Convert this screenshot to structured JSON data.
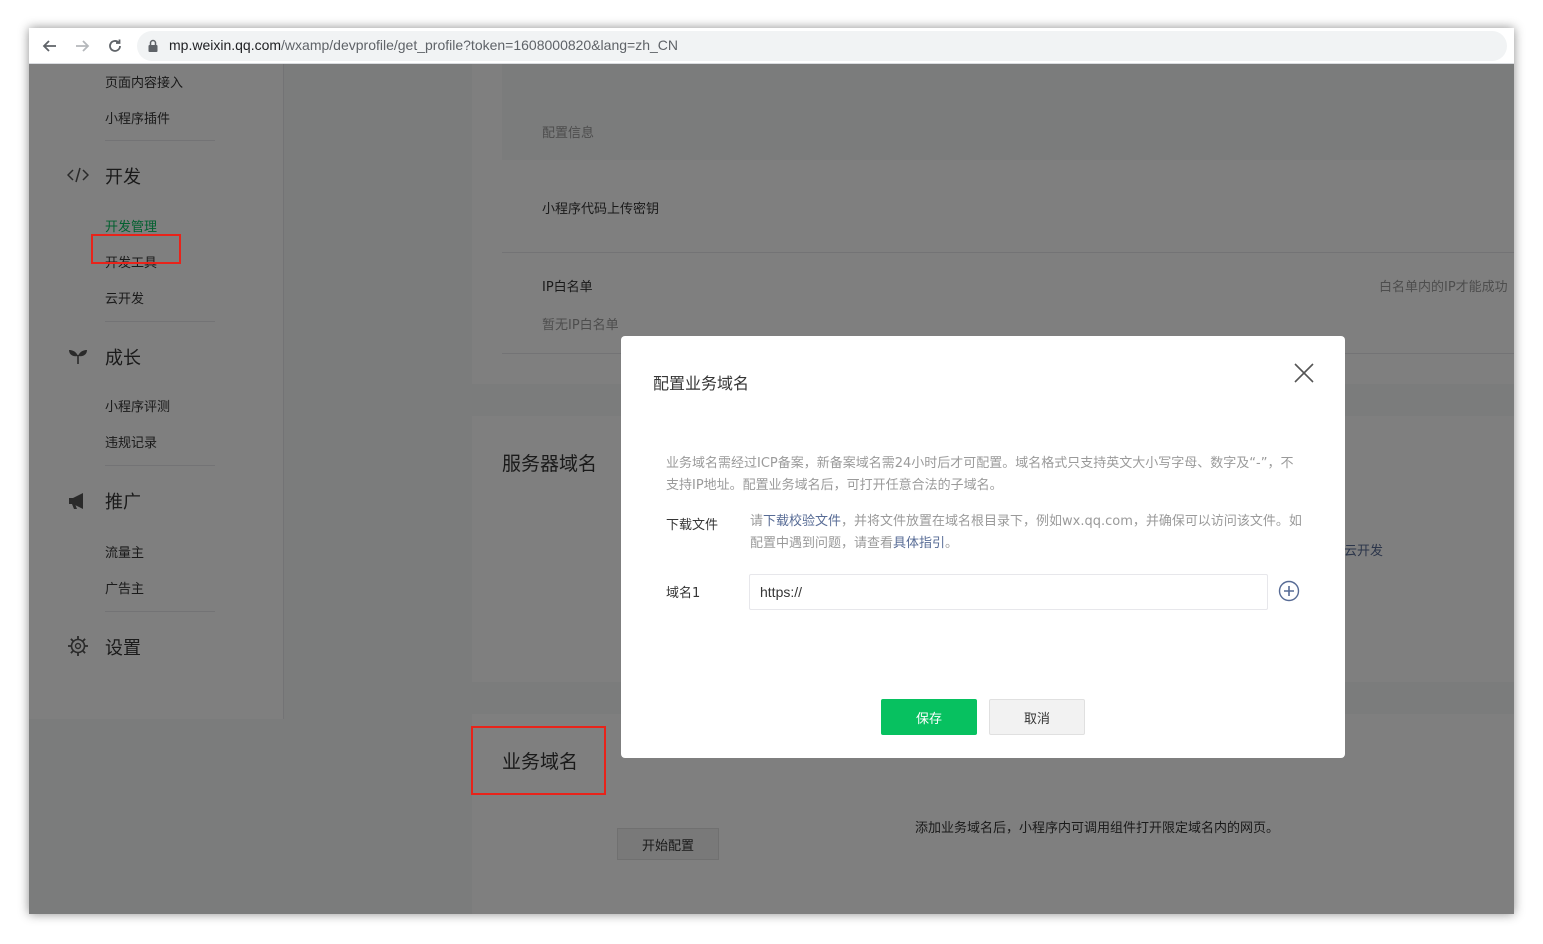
{
  "browser": {
    "url_domain": "mp.weixin.qq.com",
    "url_path": "/wxamp/devprofile/get_profile?token=1608000820&lang=zh_CN"
  },
  "sidebar": {
    "items_top": [
      "页面内容接入",
      "小程序插件"
    ],
    "categories": {
      "dev": {
        "label": "开发",
        "items": [
          "开发管理",
          "开发工具",
          "云开发"
        ]
      },
      "growth": {
        "label": "成长",
        "items": [
          "小程序评测",
          "违规记录"
        ]
      },
      "promo": {
        "label": "推广",
        "items": [
          "流量主",
          "广告主"
        ]
      },
      "settings": {
        "label": "设置"
      }
    }
  },
  "main": {
    "config_info": "配置信息",
    "upload_key": "小程序代码上传密钥",
    "ip_whitelist": "IP白名单",
    "ip_whitelist_note": "白名单内的IP才能成功",
    "ip_empty": "暂无IP白名单",
    "server_domain_title": "服务器域名",
    "cloud_dev_link": "云开发",
    "business_domain_title": "业务域名",
    "business_domain_desc": "添加业务域名后，小程序内可调用组件打开限定域名内的网页。",
    "start_config_button": "开始配置"
  },
  "dialog": {
    "title": "配置业务域名",
    "description": "业务域名需经过ICP备案，新备案域名需24小时后才可配置。域名格式只支持英文大小写字母、数字及“-”，不支持IP地址。配置业务域名后，可打开任意合法的子域名。",
    "download_label": "下载文件",
    "download_text_1": "请",
    "download_link": "下载校验文件",
    "download_text_2": "，并将文件放置在域名根目录下，例如wx.qq.com，并确保可以访问该文件。如配置中遇到问题，请查看",
    "guide_link": "具体指引",
    "download_text_3": "。",
    "domain_label": "域名1",
    "domain_value": "https://",
    "save_button": "保存",
    "cancel_button": "取消"
  },
  "colors": {
    "accent": "#07c160",
    "highlight_box": "#e8231a",
    "link": "#576b95"
  }
}
